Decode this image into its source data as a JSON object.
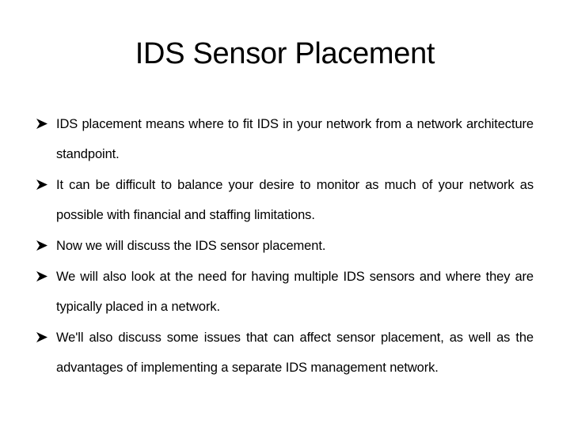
{
  "slide": {
    "title": "IDS Sensor Placement",
    "bullet_icon": "arrowhead-bullet-icon",
    "bullets": [
      {
        "text": "IDS placement means where to fit IDS in your network from a network architecture standpoint."
      },
      {
        "text": "It can be difficult to balance your desire to monitor as much of your network as possible with financial and staffing limitations."
      },
      {
        "text": "Now we will discuss the IDS sensor placement."
      },
      {
        "text": "We will also look  at the need for having multiple IDS sensors and where they are typically placed in a network."
      },
      {
        "text": "We'll also discuss some issues that can affect sensor placement, as well as the advantages of implementing a separate IDS management network."
      }
    ]
  }
}
